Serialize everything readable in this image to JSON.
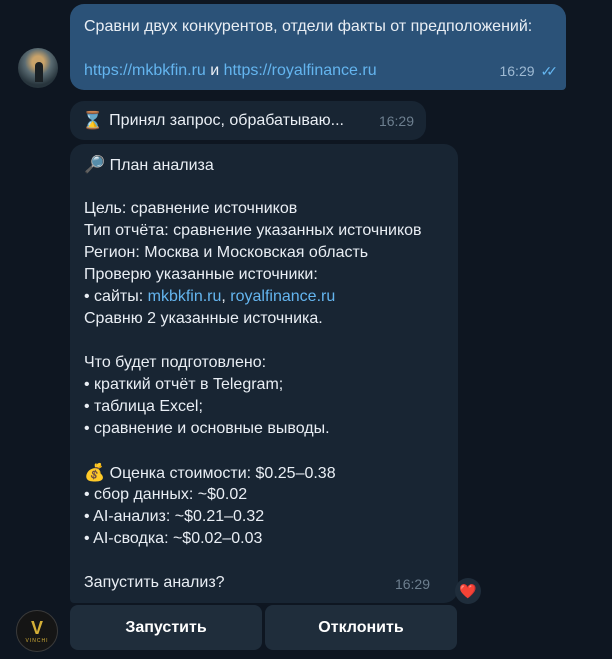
{
  "outgoing": {
    "line1": "Сравни двух конкурентов, отдели факты от предположений:",
    "link1": "https://mkbkfin.ru",
    "conj": " и ",
    "link2": "https://royalfinance.ru",
    "time": "16:29",
    "read_icon": "double-check-icon"
  },
  "status": {
    "icon": "⌛",
    "text": "Принял запрос, обрабатываю...",
    "time": "16:29"
  },
  "plan": {
    "title_icon": "🔎",
    "title": "План анализа",
    "goal": "Цель: сравнение источников",
    "report_type": "Тип отчёта: сравнение указанных источников",
    "region": "Регион: Москва и Московская область",
    "check_sources": "Проверю указанные источники:",
    "sites_prefix": "• сайты: ",
    "site1": "mkbkfin.ru",
    "sites_sep": ", ",
    "site2": "royalfinance.ru",
    "compare": "Сравню 2 указанные источника.",
    "prepared_title": "Что будет подготовлено:",
    "prepared_items": [
      "• краткий отчёт в Telegram;",
      "• таблица Excel;",
      "• сравнение и основные выводы."
    ],
    "cost_icon": "💰",
    "cost_title": "Оценка стоимости: $0.25–0.38",
    "cost_items": [
      "• сбор данных: ~$0.02",
      "• AI-анализ: ~$0.21–0.32",
      "• AI-сводка: ~$0.02–0.03"
    ],
    "question": "Запустить анализ?",
    "time": "16:29",
    "reaction": "❤️"
  },
  "buttons": {
    "start": "Запустить",
    "decline": "Отклонить"
  },
  "bot_avatar": {
    "letter": "V",
    "caption": "VINCHI"
  }
}
